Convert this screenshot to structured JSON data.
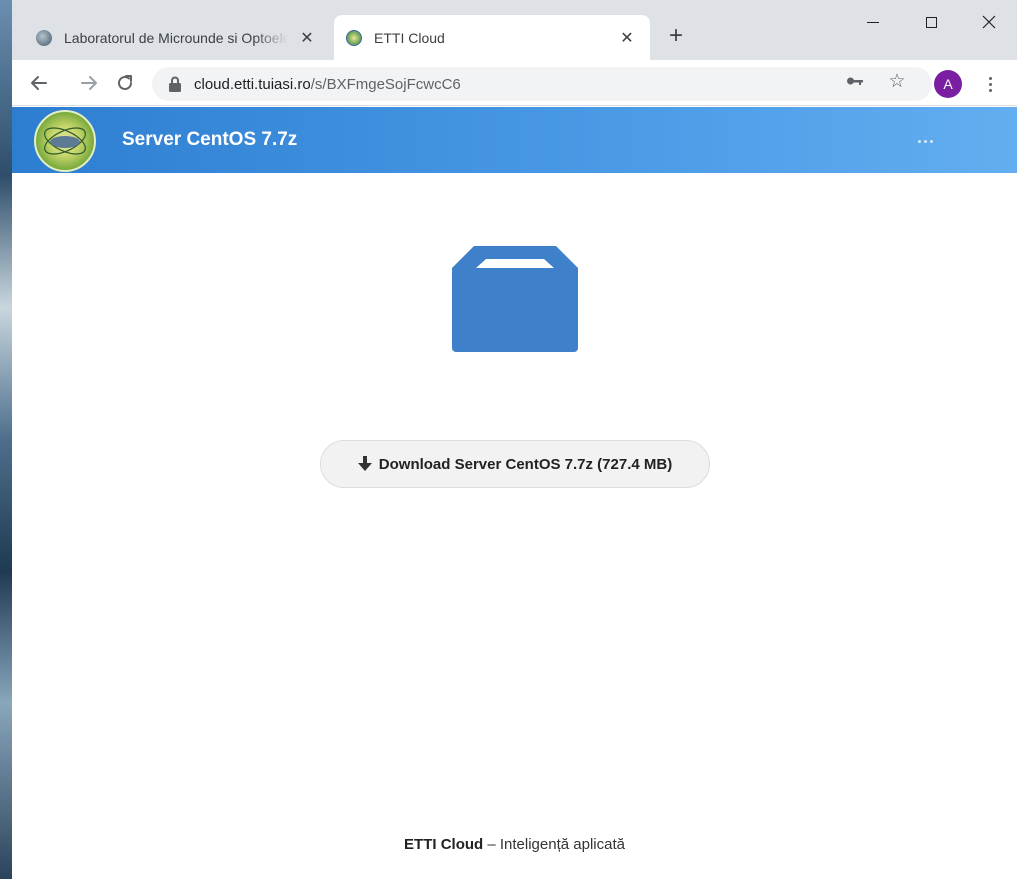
{
  "browser": {
    "tabs": [
      {
        "title": "Laboratorul de Microunde si Optoelectronica",
        "active": false
      },
      {
        "title": "ETTI Cloud",
        "active": true
      }
    ],
    "new_tab_label": "+",
    "url": {
      "host": "cloud.etti.tuiasi.ro",
      "path": "/s/BXFmgeSojFcwcC6"
    },
    "profile_initial": "A",
    "icons": [
      "back-arrow-icon",
      "forward-arrow-icon",
      "reload-icon",
      "lock-icon",
      "key-icon",
      "star-icon",
      "kebab-menu-icon",
      "minimize-icon",
      "maximize-icon",
      "close-icon"
    ]
  },
  "header": {
    "title": "Server CentOS 7.7z",
    "menu_icon": "ellipsis-icon"
  },
  "main": {
    "file_icon": "package-icon",
    "download_label": "Download Server CentOS 7.7z (727.4 MB)",
    "download_icon": "download-arrow-icon"
  },
  "footer": {
    "brand": "ETTI Cloud",
    "separator": " – ",
    "tagline": "Inteligență aplicată"
  },
  "colors": {
    "header_start": "#2d7ed1",
    "header_end": "#63aef0",
    "file_icon": "#3e80c9",
    "avatar": "#7b1fa2"
  }
}
